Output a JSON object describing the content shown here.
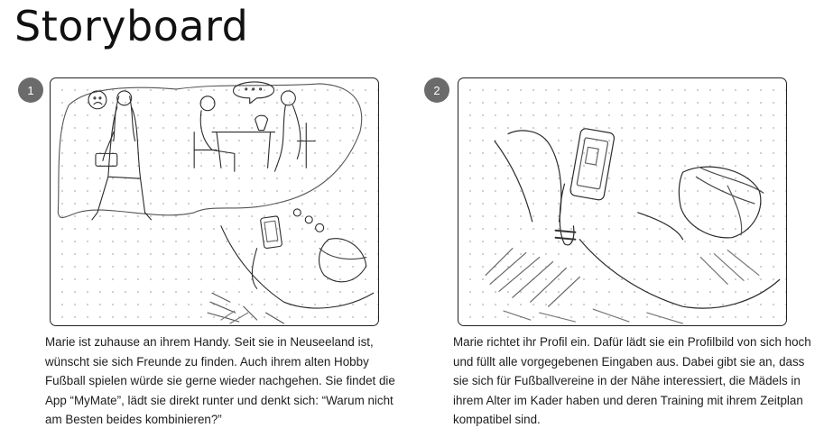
{
  "page": {
    "title": "Storyboard"
  },
  "panels": [
    {
      "number": "1",
      "caption": "Marie ist zuhause an ihrem Handy. Seit sie in Neuseeland ist, wünscht sie sich Freunde zu finden. Auch ihrem alten Hobby Fußball spielen würde sie gerne wieder nachgehen. Sie findet die App “MyMate”, lädt sie direkt runter und denkt sich: “Warum nicht am Besten beides kombinieren?”"
    },
    {
      "number": "2",
      "caption": "Marie richtet ihr Profil ein. Dafür lädt sie ein Profilbild von sich hoch und füllt alle vorgegebenen Eingaben aus. Dabei gibt sie an, dass sie sich für Fußballvereine in der Nähe interessiert, die Mädels in ihrem Alter im Kader haben und deren Training mit ihrem Zeitplan kompatibel sind."
    }
  ]
}
